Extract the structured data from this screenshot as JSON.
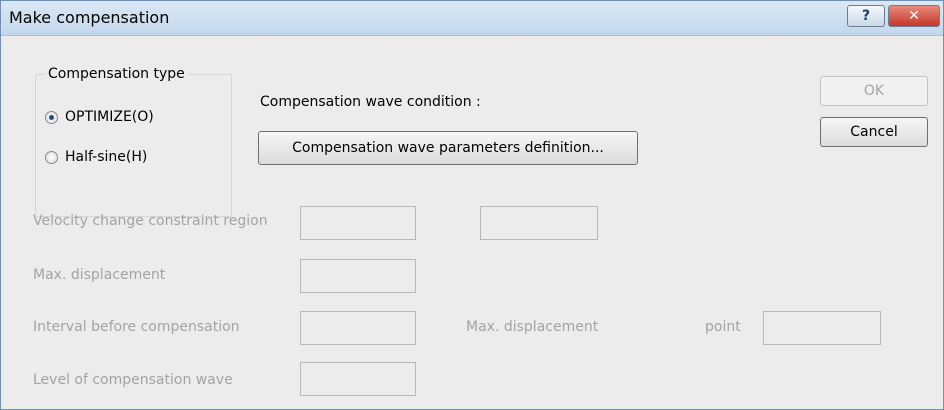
{
  "window": {
    "title": "Make compensation",
    "help_label": "?",
    "close_label": "✕"
  },
  "comp_type": {
    "group_label": "Compensation type",
    "options": [
      {
        "label": "OPTIMIZE(O)",
        "checked": true
      },
      {
        "label": "Half-sine(H)",
        "checked": false
      }
    ]
  },
  "wave": {
    "condition_label": "Compensation wave condition :",
    "params_button": "Compensation wave parameters definition..."
  },
  "buttons": {
    "ok": "OK",
    "cancel": "Cancel"
  },
  "fields": {
    "velocity_label": "Velocity change constraint region",
    "max_disp_label": "Max. displacement",
    "interval_label": "Interval before compensation",
    "max_disp2_label": "Max. displacement",
    "point_label": "point",
    "level_label": "Level of compensation wave"
  }
}
